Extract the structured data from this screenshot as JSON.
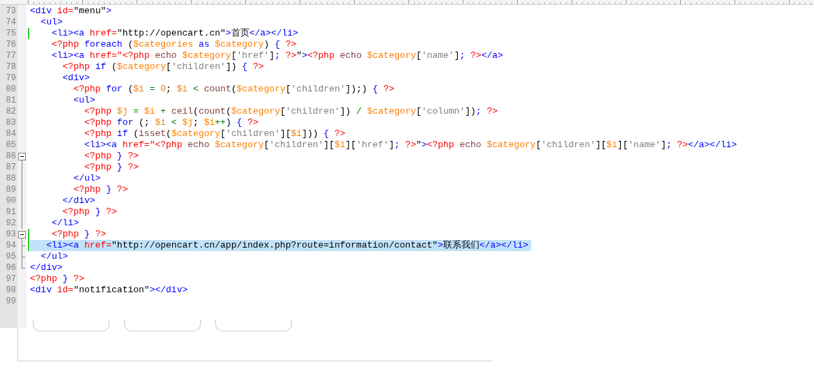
{
  "editor": {
    "lines": [
      {
        "number": "73",
        "selected": false,
        "modified": false,
        "tokens": [
          {
            "kind": "tag",
            "text": "<div"
          },
          {
            "kind": "attr",
            "text": " id="
          },
          {
            "kind": "str",
            "text": "\"menu\""
          },
          {
            "kind": "tag",
            "text": ">"
          }
        ]
      },
      {
        "number": "74",
        "selected": false,
        "modified": false,
        "tokens": [
          {
            "kind": "tag",
            "text": "  <ul>"
          }
        ]
      },
      {
        "number": "75",
        "selected": false,
        "modified": true,
        "tokens": [
          {
            "kind": "tag",
            "text": "    <li><a"
          },
          {
            "kind": "attr",
            "text": " href="
          },
          {
            "kind": "str",
            "text": "\"http://opencart.cn\""
          },
          {
            "kind": "tag",
            "text": ">"
          },
          {
            "kind": "plain",
            "text": "首页"
          },
          {
            "kind": "tag",
            "text": "</a></li>"
          }
        ]
      },
      {
        "number": "76",
        "selected": false,
        "modified": false,
        "tokens": [
          {
            "kind": "php",
            "text": "    <?php"
          },
          {
            "kind": "kw",
            "text": " foreach"
          },
          {
            "kind": "plain",
            "text": " ("
          },
          {
            "kind": "var",
            "text": "$categories"
          },
          {
            "kind": "kw",
            "text": " as"
          },
          {
            "kind": "var",
            "text": " $category"
          },
          {
            "kind": "plain",
            "text": ")"
          },
          {
            "kind": "brace",
            "text": " {"
          },
          {
            "kind": "php",
            "text": " ?>"
          }
        ]
      },
      {
        "number": "77",
        "selected": false,
        "modified": false,
        "tokens": [
          {
            "kind": "tag",
            "text": "    <li><a"
          },
          {
            "kind": "attr",
            "text": " href=\""
          },
          {
            "kind": "php",
            "text": "<?php"
          },
          {
            "kind": "fn",
            "text": " echo"
          },
          {
            "kind": "var",
            "text": " $category"
          },
          {
            "kind": "plain",
            "text": "["
          },
          {
            "kind": "sq",
            "text": "'href'"
          },
          {
            "kind": "plain",
            "text": "]"
          },
          {
            "kind": "brace",
            "text": ";"
          },
          {
            "kind": "php",
            "text": " ?>"
          },
          {
            "kind": "str",
            "text": "\""
          },
          {
            "kind": "tag",
            "text": ">"
          },
          {
            "kind": "php",
            "text": "<?php"
          },
          {
            "kind": "fn",
            "text": " echo"
          },
          {
            "kind": "var",
            "text": " $category"
          },
          {
            "kind": "plain",
            "text": "["
          },
          {
            "kind": "sq",
            "text": "'name'"
          },
          {
            "kind": "plain",
            "text": "]"
          },
          {
            "kind": "brace",
            "text": ";"
          },
          {
            "kind": "php",
            "text": " ?>"
          },
          {
            "kind": "tag",
            "text": "</a>"
          }
        ]
      },
      {
        "number": "78",
        "selected": false,
        "modified": false,
        "tokens": [
          {
            "kind": "php",
            "text": "      <?php"
          },
          {
            "kind": "kw",
            "text": " if"
          },
          {
            "kind": "plain",
            "text": " ("
          },
          {
            "kind": "var",
            "text": "$category"
          },
          {
            "kind": "plain",
            "text": "["
          },
          {
            "kind": "sq",
            "text": "'children'"
          },
          {
            "kind": "plain",
            "text": "])"
          },
          {
            "kind": "brace",
            "text": " {"
          },
          {
            "kind": "php",
            "text": " ?>"
          }
        ]
      },
      {
        "number": "79",
        "selected": false,
        "modified": false,
        "tokens": [
          {
            "kind": "tag",
            "text": "      <div>"
          }
        ]
      },
      {
        "number": "80",
        "selected": false,
        "modified": false,
        "tokens": [
          {
            "kind": "php",
            "text": "        <?php"
          },
          {
            "kind": "kw",
            "text": " for"
          },
          {
            "kind": "plain",
            "text": " ("
          },
          {
            "kind": "var",
            "text": "$i"
          },
          {
            "kind": "op",
            "text": " ="
          },
          {
            "kind": "num",
            "text": " 0"
          },
          {
            "kind": "plain",
            "text": ";"
          },
          {
            "kind": "var",
            "text": " $i"
          },
          {
            "kind": "op",
            "text": " <"
          },
          {
            "kind": "fn",
            "text": " count"
          },
          {
            "kind": "plain",
            "text": "("
          },
          {
            "kind": "var",
            "text": "$category"
          },
          {
            "kind": "plain",
            "text": "["
          },
          {
            "kind": "sq",
            "text": "'children'"
          },
          {
            "kind": "plain",
            "text": "]);)"
          },
          {
            "kind": "brace",
            "text": " {"
          },
          {
            "kind": "php",
            "text": " ?>"
          }
        ]
      },
      {
        "number": "81",
        "selected": false,
        "modified": false,
        "tokens": [
          {
            "kind": "tag",
            "text": "        <ul>"
          }
        ]
      },
      {
        "number": "82",
        "selected": false,
        "modified": false,
        "tokens": [
          {
            "kind": "php",
            "text": "          <?php"
          },
          {
            "kind": "var",
            "text": " $j"
          },
          {
            "kind": "op",
            "text": " ="
          },
          {
            "kind": "var",
            "text": " $i"
          },
          {
            "kind": "op",
            "text": " +"
          },
          {
            "kind": "fn",
            "text": " ceil"
          },
          {
            "kind": "plain",
            "text": "("
          },
          {
            "kind": "fn",
            "text": "count"
          },
          {
            "kind": "plain",
            "text": "("
          },
          {
            "kind": "var",
            "text": "$category"
          },
          {
            "kind": "plain",
            "text": "["
          },
          {
            "kind": "sq",
            "text": "'children'"
          },
          {
            "kind": "plain",
            "text": "])"
          },
          {
            "kind": "op",
            "text": " /"
          },
          {
            "kind": "var",
            "text": " $category"
          },
          {
            "kind": "plain",
            "text": "["
          },
          {
            "kind": "sq",
            "text": "'column'"
          },
          {
            "kind": "plain",
            "text": "])"
          },
          {
            "kind": "brace",
            "text": ";"
          },
          {
            "kind": "php",
            "text": " ?>"
          }
        ]
      },
      {
        "number": "83",
        "selected": false,
        "modified": false,
        "tokens": [
          {
            "kind": "php",
            "text": "          <?php"
          },
          {
            "kind": "kw",
            "text": " for"
          },
          {
            "kind": "plain",
            "text": " (;"
          },
          {
            "kind": "var",
            "text": " $i"
          },
          {
            "kind": "op",
            "text": " <"
          },
          {
            "kind": "var",
            "text": " $j"
          },
          {
            "kind": "plain",
            "text": ";"
          },
          {
            "kind": "var",
            "text": " $i"
          },
          {
            "kind": "op",
            "text": "++"
          },
          {
            "kind": "plain",
            "text": ")"
          },
          {
            "kind": "brace",
            "text": " {"
          },
          {
            "kind": "php",
            "text": " ?>"
          }
        ]
      },
      {
        "number": "84",
        "selected": false,
        "modified": false,
        "tokens": [
          {
            "kind": "php",
            "text": "          <?php"
          },
          {
            "kind": "kw",
            "text": " if"
          },
          {
            "kind": "plain",
            "text": " ("
          },
          {
            "kind": "fn",
            "text": "isset"
          },
          {
            "kind": "plain",
            "text": "("
          },
          {
            "kind": "var",
            "text": "$category"
          },
          {
            "kind": "plain",
            "text": "["
          },
          {
            "kind": "sq",
            "text": "'children'"
          },
          {
            "kind": "plain",
            "text": "]["
          },
          {
            "kind": "var",
            "text": "$i"
          },
          {
            "kind": "plain",
            "text": "]))"
          },
          {
            "kind": "brace",
            "text": " {"
          },
          {
            "kind": "php",
            "text": " ?>"
          }
        ]
      },
      {
        "number": "85",
        "selected": false,
        "modified": false,
        "tokens": [
          {
            "kind": "tag",
            "text": "          <li><a"
          },
          {
            "kind": "attr",
            "text": " href=\""
          },
          {
            "kind": "php",
            "text": "<?php"
          },
          {
            "kind": "fn",
            "text": " echo"
          },
          {
            "kind": "var",
            "text": " $category"
          },
          {
            "kind": "plain",
            "text": "["
          },
          {
            "kind": "sq",
            "text": "'children'"
          },
          {
            "kind": "plain",
            "text": "]["
          },
          {
            "kind": "var",
            "text": "$i"
          },
          {
            "kind": "plain",
            "text": "]["
          },
          {
            "kind": "sq",
            "text": "'href'"
          },
          {
            "kind": "plain",
            "text": "]"
          },
          {
            "kind": "brace",
            "text": ";"
          },
          {
            "kind": "php",
            "text": " ?>"
          },
          {
            "kind": "str",
            "text": "\""
          },
          {
            "kind": "tag",
            "text": ">"
          },
          {
            "kind": "php",
            "text": "<?php"
          },
          {
            "kind": "fn",
            "text": " echo"
          },
          {
            "kind": "var",
            "text": " $category"
          },
          {
            "kind": "plain",
            "text": "["
          },
          {
            "kind": "sq",
            "text": "'children'"
          },
          {
            "kind": "plain",
            "text": "]["
          },
          {
            "kind": "var",
            "text": "$i"
          },
          {
            "kind": "plain",
            "text": "]["
          },
          {
            "kind": "sq",
            "text": "'name'"
          },
          {
            "kind": "plain",
            "text": "]"
          },
          {
            "kind": "brace",
            "text": ";"
          },
          {
            "kind": "php",
            "text": " ?>"
          },
          {
            "kind": "tag",
            "text": "</a></li>"
          }
        ]
      },
      {
        "number": "86",
        "selected": false,
        "modified": false,
        "fold": {
          "kind": "box"
        },
        "tokens": [
          {
            "kind": "php",
            "text": "          <?php"
          },
          {
            "kind": "brace",
            "text": " }"
          },
          {
            "kind": "php",
            "text": " ?>"
          }
        ]
      },
      {
        "number": "87",
        "selected": false,
        "modified": false,
        "fold": {
          "kind": "line"
        },
        "tokens": [
          {
            "kind": "php",
            "text": "          <?php"
          },
          {
            "kind": "brace",
            "text": " }"
          },
          {
            "kind": "php",
            "text": " ?>"
          }
        ]
      },
      {
        "number": "88",
        "selected": false,
        "modified": false,
        "fold": {
          "kind": "line"
        },
        "tokens": [
          {
            "kind": "tag",
            "text": "        </ul>"
          }
        ]
      },
      {
        "number": "89",
        "selected": false,
        "modified": false,
        "fold": {
          "kind": "line"
        },
        "tokens": [
          {
            "kind": "php",
            "text": "        <?php"
          },
          {
            "kind": "brace",
            "text": " }"
          },
          {
            "kind": "php",
            "text": " ?>"
          }
        ]
      },
      {
        "number": "90",
        "selected": false,
        "modified": false,
        "fold": {
          "kind": "line"
        },
        "tokens": [
          {
            "kind": "tag",
            "text": "      </div>"
          }
        ]
      },
      {
        "number": "91",
        "selected": false,
        "modified": false,
        "fold": {
          "kind": "line"
        },
        "tokens": [
          {
            "kind": "php",
            "text": "      <?php"
          },
          {
            "kind": "brace",
            "text": " }"
          },
          {
            "kind": "php",
            "text": " ?>"
          }
        ]
      },
      {
        "number": "92",
        "selected": false,
        "modified": false,
        "fold": {
          "kind": "line"
        },
        "tokens": [
          {
            "kind": "tag",
            "text": "    </li>"
          }
        ]
      },
      {
        "number": "93",
        "selected": false,
        "modified": true,
        "fold": {
          "kind": "box"
        },
        "tokens": [
          {
            "kind": "php",
            "text": "    <?php"
          },
          {
            "kind": "brace",
            "text": " }"
          },
          {
            "kind": "php",
            "text": " ?>"
          }
        ]
      },
      {
        "number": "94",
        "selected": true,
        "modified": true,
        "fold": {
          "kind": "tick"
        },
        "tokens": [
          {
            "kind": "tag",
            "text": "   <li><a"
          },
          {
            "kind": "attr",
            "text": " href="
          },
          {
            "kind": "str",
            "text": "\"http://opencart.cn/app/index.php?route=information/contact\""
          },
          {
            "kind": "tag",
            "text": ">"
          },
          {
            "kind": "plain",
            "text": "联系我们"
          },
          {
            "kind": "tag",
            "text": "</a></li>"
          }
        ]
      },
      {
        "number": "95",
        "selected": false,
        "modified": false,
        "fold": {
          "kind": "tick"
        },
        "tokens": [
          {
            "kind": "tag",
            "text": "  </ul>"
          }
        ]
      },
      {
        "number": "96",
        "selected": false,
        "modified": false,
        "fold": {
          "kind": "end"
        },
        "tokens": [
          {
            "kind": "tag",
            "text": "</div>"
          }
        ]
      },
      {
        "number": "97",
        "selected": false,
        "modified": false,
        "tokens": [
          {
            "kind": "php",
            "text": "<?php"
          },
          {
            "kind": "brace",
            "text": " }"
          },
          {
            "kind": "php",
            "text": " ?>"
          }
        ]
      },
      {
        "number": "98",
        "selected": false,
        "modified": false,
        "tokens": [
          {
            "kind": "tag",
            "text": "<div"
          },
          {
            "kind": "attr",
            "text": " id="
          },
          {
            "kind": "str",
            "text": "\"notification\""
          },
          {
            "kind": "tag",
            "text": "></div>"
          }
        ]
      },
      {
        "number": "99",
        "selected": false,
        "modified": false
      }
    ]
  }
}
